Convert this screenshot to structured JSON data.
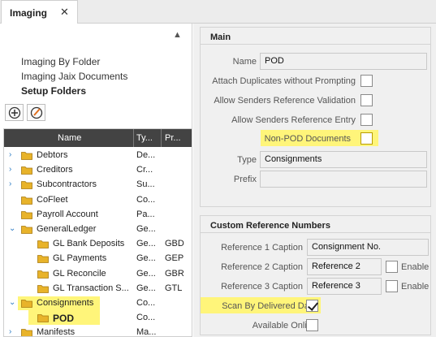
{
  "tab": {
    "label": "Imaging",
    "close": "✕"
  },
  "nav": {
    "items": [
      {
        "label": "Imaging By Folder"
      },
      {
        "label": "Imaging Jaix Documents"
      },
      {
        "label": "Setup Folders"
      }
    ]
  },
  "grid": {
    "columns": [
      "Name",
      "Ty...",
      "Pr..."
    ],
    "rows": [
      {
        "name": "Debtors",
        "type": "De...",
        "prefix": ""
      },
      {
        "name": "Creditors",
        "type": "Cr...",
        "prefix": ""
      },
      {
        "name": "Subcontractors",
        "type": "Su...",
        "prefix": ""
      },
      {
        "name": "CoFleet",
        "type": "Co...",
        "prefix": ""
      },
      {
        "name": "Payroll Account",
        "type": "Pa...",
        "prefix": ""
      },
      {
        "name": "GeneralLedger",
        "type": "Ge...",
        "prefix": ""
      },
      {
        "name": "GL Bank Deposits",
        "type": "Ge...",
        "prefix": "GBD"
      },
      {
        "name": "GL Payments",
        "type": "Ge...",
        "prefix": "GEP"
      },
      {
        "name": "GL Reconcile",
        "type": "Ge...",
        "prefix": "GBR"
      },
      {
        "name": "GL Transaction S...",
        "type": "Ge...",
        "prefix": "GTL"
      },
      {
        "name": "Consignments",
        "type": "Co...",
        "prefix": ""
      },
      {
        "name": "POD",
        "type": "Co...",
        "prefix": ""
      },
      {
        "name": "Manifests",
        "type": "Ma...",
        "prefix": ""
      }
    ]
  },
  "main": {
    "title": "Main",
    "name_label": "Name",
    "name_value": "POD",
    "attach_dup_label": "Attach Duplicates without Prompting",
    "allow_ref_validation_label": "Allow Senders Reference Validation",
    "allow_ref_entry_label": "Allow Senders Reference Entry",
    "non_pod_label": "Non-POD Documents",
    "type_label": "Type",
    "type_value": "Consignments",
    "prefix_label": "Prefix",
    "prefix_value": ""
  },
  "custom": {
    "title": "Custom Reference Numbers",
    "ref1_label": "Reference 1 Caption",
    "ref1_value": "Consignment No.",
    "ref2_label": "Reference 2 Caption",
    "ref2_value": "Reference 2",
    "ref3_label": "Reference 3 Caption",
    "ref3_value": "Reference 3",
    "enable_label": "Enable",
    "scan_label": "Scan By Delivered Date",
    "available_label": "Available Online"
  },
  "colors": {
    "highlight": "#fff57a",
    "grid_header": "#434343",
    "folder": "#e8b32a",
    "accent": "#2b7bc4"
  }
}
